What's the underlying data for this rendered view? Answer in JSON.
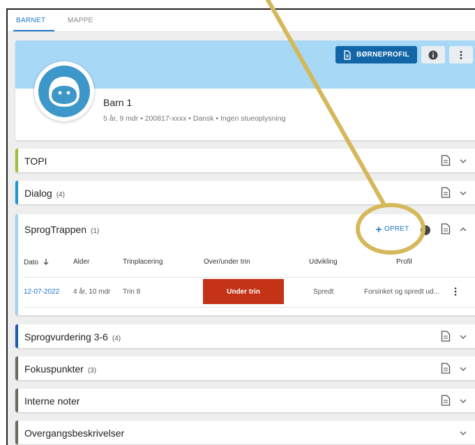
{
  "tabs": [
    {
      "label": "BARNET",
      "active": true
    },
    {
      "label": "MAPPE",
      "active": false
    }
  ],
  "profile": {
    "button_label": "BØRNEPROFIL",
    "name": "Barn 1",
    "meta": "5 år, 9 mdr • 200817-xxxx • Dansk • Ingen stueoplysning",
    "banner_color": "#a7d8f6"
  },
  "sections": {
    "topi": {
      "title": "TOPI",
      "count": "",
      "accent": "#9bc13c"
    },
    "dialog": {
      "title": "Dialog",
      "count": "(4)",
      "accent": "#2196d3"
    },
    "sprogtrappen": {
      "title": "SprogTrappen",
      "count": "(1)",
      "accent": "#9fd3f1",
      "create_label": "OPRET",
      "columns": [
        "Dato",
        "Alder",
        "Trinplacering",
        "Over/under trin",
        "Udvikling",
        "Profil"
      ],
      "rows": [
        {
          "date": "12-07-2022",
          "age": "4 år, 10 mdr",
          "step": "Trin 8",
          "status": "Under trin",
          "development": "Spredt",
          "profile": "Forsinket og spredt ud..."
        }
      ]
    },
    "sprogvurdering": {
      "title": "Sprogvurdering 3-6",
      "count": "(4)",
      "accent": "#1f5fa8"
    },
    "fokuspunkter": {
      "title": "Fokuspunkter",
      "count": "(3)",
      "accent": "#6b6b5a"
    },
    "interne": {
      "title": "Interne noter",
      "count": "",
      "accent": "#6b6b5a"
    },
    "overgang": {
      "title": "Overgangsbeskrivelser",
      "count": "",
      "accent": "#6b6b5a"
    }
  },
  "colors": {
    "primary": "#1266a8",
    "link": "#1f76c6",
    "danger": "#c43316",
    "annotation": "#d4b85a"
  }
}
